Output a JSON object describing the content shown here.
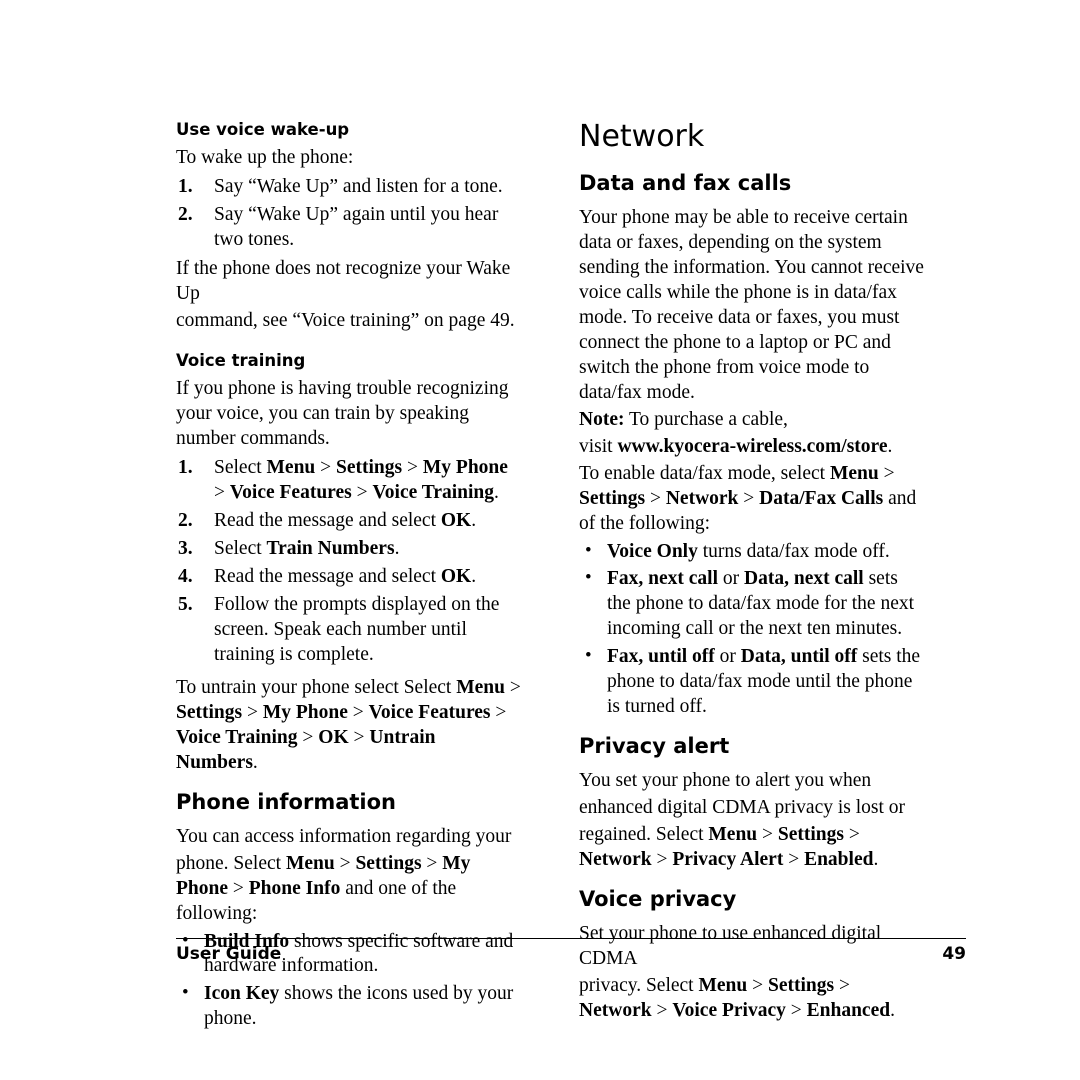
{
  "document": {
    "footer_left": "User Guide",
    "page_number": "49"
  },
  "left_column": {
    "heading_use_voice_wakeup": "Use voice wake-up",
    "intro": "To wake up the phone:",
    "steps": [
      {
        "marker": "1.",
        "text": "Say “Wake Up” and listen for a tone."
      },
      {
        "marker": "2.",
        "text": "Say “Wake Up” again until you hear two tones."
      }
    ],
    "wakeup_note_1": "If the phone does not recognize your Wake Up",
    "wakeup_note_2": "command, see “Voice training” on page 49.",
    "heading_voice_training": "Voice training",
    "voice_training_intro": "If you phone is having trouble recognizing your voice, you can train by speaking number commands.",
    "vt_step1_pre": "Select ",
    "vt_step1_menu": "Menu",
    "vt_step1_gt1": " > ",
    "vt_step1_settings": "Settings",
    "vt_step1_gt2": " > ",
    "vt_step1_myphone": "My Phone",
    "vt_step1_gt3": " > ",
    "vt_step1_voicefeatures": "Voice Features",
    "vt_step1_gt4": " > ",
    "vt_step1_voicetraining": "Voice Training",
    "vt_step1_period": ".",
    "vt_step2_pre": "Read the message and select ",
    "vt_step2_ok": "OK",
    "vt_step2_period": ".",
    "vt_step3_pre": "Select ",
    "vt_step3_train": "Train Numbers",
    "vt_step3_period": ".",
    "vt_step4_pre": "Read the message and select ",
    "vt_step4_ok": "OK",
    "vt_step4_period": ".",
    "vt_step5": "Follow the prompts displayed on the screen. Speak each number until training is complete.",
    "untrain_pre": "To untrain your phone select Select ",
    "untrain_menu": "Menu",
    "untrain_gt1": " > ",
    "untrain_settings": "Settings",
    "untrain_gt2": " > ",
    "untrain_myphone": "My Phone",
    "untrain_gt3": " > ",
    "untrain_voicefeatures": "Voice Features",
    "untrain_gt4": " > ",
    "untrain_voicetraining": "Voice Training",
    "untrain_gt5": " > ",
    "untrain_ok": "OK",
    "untrain_gt6": " > ",
    "untrain_numbers": "Untrain Numbers",
    "untrain_period": ".",
    "heading_phone_information": "Phone information",
    "pi_line1": "You can access information regarding your",
    "pi_line2_pre": "phone. Select ",
    "pi_menu": "Menu",
    "pi_gt1": " > ",
    "pi_settings": "Settings",
    "pi_gt2": " > ",
    "pi_myphone": "My Phone",
    "pi_gt3": " > ",
    "pi_phoneinfo": "Phone Info",
    "pi_tail": " and one of the following:",
    "pi_bullets": [
      {
        "bold": "Build Info",
        "rest": " shows specific software and hardware information."
      },
      {
        "bold": "Icon Key",
        "rest": " shows the icons used by your phone."
      }
    ]
  },
  "right_column": {
    "heading_network": "Network",
    "heading_data_fax": "Data and fax calls",
    "data_fax_para": "Your phone may be able to receive certain data or faxes, depending on the system sending the information. You cannot receive voice calls while the phone is in data/fax mode. To receive data or faxes, you must connect the phone to a laptop or PC and switch the phone from voice mode to data/fax mode.",
    "note_label": "Note:",
    "note_text": " To purchase a cable,",
    "visit_pre": "visit ",
    "visit_url": "www.kyocera-wireless.com/store",
    "visit_period": ".",
    "enable_pre": "To enable data/fax mode, select ",
    "enable_menu": "Menu",
    "enable_gt1": " > ",
    "enable_settings": "Settings",
    "enable_gt2": " > ",
    "enable_network": "Network",
    "enable_gt3": " > ",
    "enable_datafaxcalls": "Data/Fax Calls",
    "enable_tail": " and of",
    "enable_tail2": "the following:",
    "datafax_bullets": [
      {
        "bold": "Voice Only",
        "rest": " turns data/fax mode off.",
        "bold2": "",
        "mid": "",
        "rest2": ""
      },
      {
        "bold": "Fax, next call",
        "mid": " or ",
        "bold2": "Data, next call",
        "rest2": " sets the phone to data/fax mode for the next incoming call or the next ten minutes.",
        "rest": ""
      },
      {
        "bold": "Fax, until off",
        "mid": " or ",
        "bold2": "Data, until off",
        "rest2": " sets the phone to data/fax mode until the phone is turned off.",
        "rest": ""
      }
    ],
    "heading_privacy_alert": "Privacy alert",
    "pa_line1": "You set your phone to alert you when",
    "pa_line2": "enhanced digital CDMA privacy is lost or",
    "pa_line3_pre": "regained. Select ",
    "pa_menu": "Menu",
    "pa_gt1": " > ",
    "pa_settings": "Settings",
    "pa_gt2": " > ",
    "pa_network": "Network",
    "pa_gt3": " > ",
    "pa_privacyalert": "Privacy Alert",
    "pa_gt4": " > ",
    "pa_enabled": "Enabled",
    "pa_period": ".",
    "heading_voice_privacy": "Voice privacy",
    "vp_line1": "Set your phone to use enhanced digital CDMA",
    "vp_line2_pre": "privacy. Select ",
    "vp_menu": "Menu",
    "vp_gt1": " > ",
    "vp_settings": "Settings",
    "vp_gt2": " > ",
    "vp_network": "Network",
    "vp_gt3": " > ",
    "vp_voiceprivacy": "Voice Privacy",
    "vp_gt4": " > ",
    "vp_enhanced": "Enhanced",
    "vp_period": "."
  }
}
